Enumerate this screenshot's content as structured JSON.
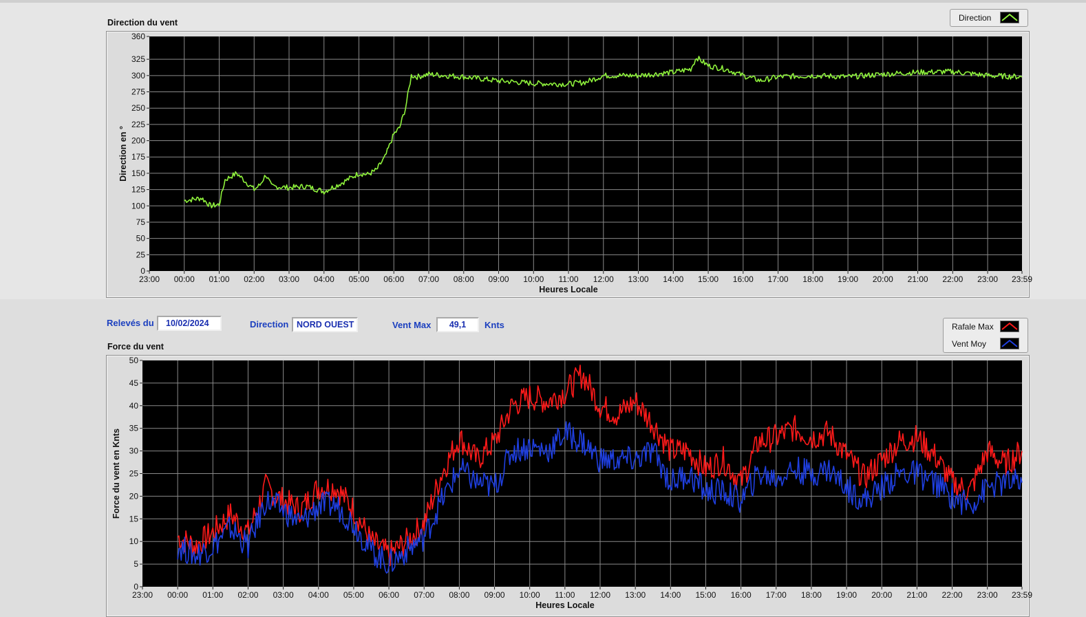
{
  "top_graph": {
    "title": "Direction du vent",
    "legend": [
      {
        "label": "Direction",
        "color": "#8ff23c"
      }
    ]
  },
  "info": {
    "releves_label": "Relevés du",
    "date": "10/02/2024",
    "direction_label": "Direction",
    "direction_value": "NORD OUEST",
    "ventmax_label": "Vent Max",
    "ventmax_value": "49,1",
    "ventmax_unit": "Knts"
  },
  "bottom_graph": {
    "title": "Force du vent",
    "legend": [
      {
        "label": "Rafale Max",
        "color": "#ff1a1a"
      },
      {
        "label": "Vent Moy",
        "color": "#1f3fe0"
      }
    ]
  },
  "chart_data": [
    {
      "type": "line",
      "title": "",
      "xlabel": "Heures Locale",
      "ylabel": "Direction en °",
      "xticks": [
        "23:00",
        "00:00",
        "01:00",
        "02:00",
        "03:00",
        "04:00",
        "05:00",
        "06:00",
        "07:00",
        "08:00",
        "09:00",
        "10:00",
        "11:00",
        "12:00",
        "13:00",
        "14:00",
        "15:00",
        "16:00",
        "17:00",
        "18:00",
        "19:00",
        "20:00",
        "21:00",
        "22:00",
        "23:00",
        "23:59"
      ],
      "yticks": [
        0,
        25,
        50,
        75,
        100,
        125,
        150,
        175,
        200,
        225,
        250,
        275,
        300,
        325,
        360
      ],
      "ylim": [
        0,
        360
      ],
      "grid": true,
      "legend_position": "top-right",
      "series": [
        {
          "name": "Direction",
          "color": "#8ff23c",
          "x": [
            "00:00",
            "00:30",
            "00:45",
            "01:00",
            "01:10",
            "01:30",
            "02:00",
            "02:10",
            "02:20",
            "02:30",
            "03:00",
            "03:30",
            "04:00",
            "04:30",
            "05:00",
            "05:15",
            "05:30",
            "05:45",
            "06:00",
            "06:10",
            "06:20",
            "06:30",
            "06:40",
            "07:00",
            "07:30",
            "08:00",
            "09:00",
            "10:00",
            "11:00",
            "11:30",
            "12:00",
            "13:00",
            "14:00",
            "14:30",
            "14:40",
            "15:00",
            "15:30",
            "16:00",
            "16:30",
            "17:00",
            "18:00",
            "19:00",
            "20:00",
            "21:00",
            "22:00",
            "23:00",
            "23:59"
          ],
          "y": [
            108,
            112,
            100,
            102,
            140,
            150,
            125,
            132,
            148,
            130,
            128,
            130,
            122,
            135,
            150,
            148,
            155,
            175,
            210,
            220,
            250,
            300,
            298,
            302,
            300,
            298,
            292,
            288,
            287,
            290,
            300,
            300,
            305,
            310,
            328,
            315,
            310,
            300,
            292,
            298,
            300,
            298,
            302,
            305,
            306,
            300,
            298
          ]
        }
      ]
    },
    {
      "type": "line",
      "title": "",
      "xlabel": "Heures Locale",
      "ylabel": "Force du vent en Knts",
      "xticks": [
        "23:00",
        "00:00",
        "01:00",
        "02:00",
        "03:00",
        "04:00",
        "05:00",
        "06:00",
        "07:00",
        "08:00",
        "09:00",
        "10:00",
        "11:00",
        "12:00",
        "13:00",
        "14:00",
        "15:00",
        "16:00",
        "17:00",
        "18:00",
        "19:00",
        "20:00",
        "21:00",
        "22:00",
        "23:00",
        "23:59"
      ],
      "yticks": [
        0,
        5,
        10,
        15,
        20,
        25,
        30,
        35,
        40,
        45,
        50
      ],
      "ylim": [
        0,
        50
      ],
      "grid": true,
      "legend_position": "top-right",
      "series": [
        {
          "name": "Rafale Max",
          "color": "#ff1a1a",
          "x": [
            "00:00",
            "00:30",
            "01:00",
            "01:30",
            "02:00",
            "02:30",
            "03:00",
            "03:30",
            "04:00",
            "04:30",
            "05:00",
            "05:30",
            "06:00",
            "06:30",
            "07:00",
            "07:30",
            "08:00",
            "08:30",
            "09:00",
            "09:30",
            "10:00",
            "10:30",
            "11:00",
            "11:30",
            "12:00",
            "12:30",
            "13:00",
            "13:30",
            "14:00",
            "14:30",
            "15:00",
            "15:30",
            "16:00",
            "16:30",
            "17:00",
            "17:30",
            "18:00",
            "18:30",
            "19:00",
            "19:30",
            "20:00",
            "20:30",
            "21:00",
            "21:30",
            "22:00",
            "22:30",
            "23:00",
            "23:30",
            "23:59"
          ],
          "y": [
            11,
            9,
            12,
            16,
            12,
            22,
            19,
            17,
            22,
            22,
            17,
            10,
            7,
            10,
            14,
            25,
            33,
            28,
            32,
            40,
            42,
            41,
            43,
            47,
            40,
            38,
            41,
            36,
            30,
            30,
            26,
            28,
            23,
            32,
            33,
            35,
            33,
            34,
            29,
            24,
            28,
            32,
            33,
            29,
            23,
            21,
            30,
            27,
            30
          ]
        },
        {
          "name": "Vent Moy",
          "color": "#1f3fe0",
          "x": [
            "00:00",
            "00:30",
            "01:00",
            "01:30",
            "02:00",
            "02:30",
            "03:00",
            "03:30",
            "04:00",
            "04:30",
            "05:00",
            "05:30",
            "06:00",
            "06:30",
            "07:00",
            "07:30",
            "08:00",
            "08:30",
            "09:00",
            "09:30",
            "10:00",
            "10:30",
            "11:00",
            "11:30",
            "12:00",
            "12:30",
            "13:00",
            "13:30",
            "14:00",
            "14:30",
            "15:00",
            "15:30",
            "16:00",
            "16:30",
            "17:00",
            "17:30",
            "18:00",
            "18:30",
            "19:00",
            "19:30",
            "20:00",
            "20:30",
            "21:00",
            "21:30",
            "22:00",
            "22:30",
            "23:00",
            "23:30",
            "23:59"
          ],
          "y": [
            9,
            7,
            9,
            13,
            9,
            19,
            17,
            14,
            18,
            18,
            14,
            8,
            5,
            8,
            11,
            19,
            26,
            23,
            22,
            30,
            31,
            30,
            34,
            32,
            28,
            28,
            28,
            30,
            23,
            25,
            21,
            21,
            19,
            25,
            24,
            26,
            25,
            26,
            22,
            19,
            22,
            25,
            25,
            23,
            20,
            18,
            22,
            23,
            23
          ]
        }
      ]
    }
  ]
}
